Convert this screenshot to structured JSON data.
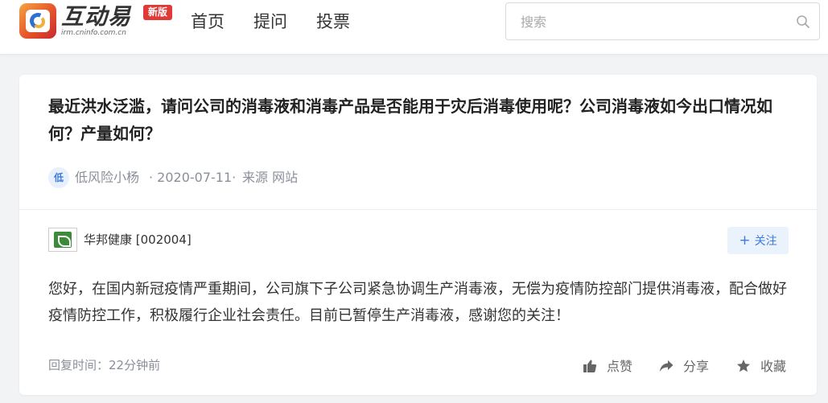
{
  "header": {
    "logo_title": "互动易",
    "logo_sub": "irm.cninfo.com.cn",
    "badge": "新版",
    "nav": [
      "首页",
      "提问",
      "投票"
    ],
    "search": {
      "placeholder": "搜索",
      "value": ""
    }
  },
  "question": {
    "text": "最近洪水泛滥，请问公司的消毒液和消毒产品是否能用于灾后消毒使用呢？公司消毒液如今出口情况如何？产量如何？",
    "avatar_char": "低",
    "author": "低风险小杨",
    "date": "· 2020-07-11·",
    "source": "来源 网站"
  },
  "answer": {
    "company": "华邦健康 [002004]",
    "follow_label": "关注",
    "text": "您好，在国内新冠疫情严重期间，公司旗下子公司紧急协调生产消毒液，无偿为疫情防控部门提供消毒液，配合做好疫情防控工作，积极履行企业社会责任。目前已暂停生产消毒液，感谢您的关注！",
    "reply_time": "回复时间：22分钟前",
    "actions": {
      "like": "点赞",
      "share": "分享",
      "favorite": "收藏"
    }
  },
  "colors": {
    "accent": "#3d7be0",
    "badge": "#e03a37",
    "page_bg": "#f2f3f5"
  },
  "icons": [
    "logo-icon",
    "search-icon",
    "plus-icon",
    "thumbs-up-icon",
    "share-icon",
    "star-icon"
  ]
}
